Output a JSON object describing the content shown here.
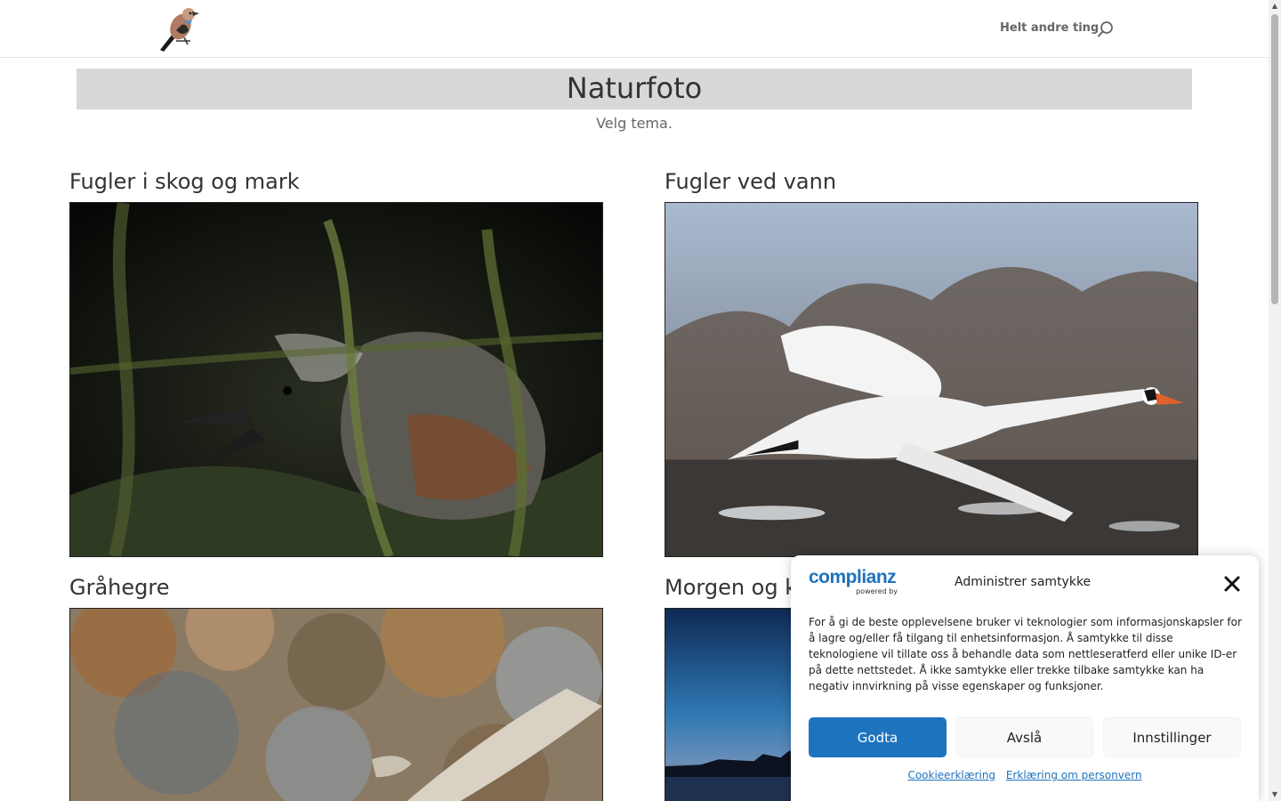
{
  "header": {
    "nav_link": "Helt andre ting"
  },
  "page": {
    "title": "Naturfoto",
    "subtitle": "Velg tema."
  },
  "galleries": [
    {
      "title": "Fugler i skog og mark"
    },
    {
      "title": "Fugler ved vann"
    },
    {
      "title": "Gråhegre"
    },
    {
      "title": "Morgen og k"
    }
  ],
  "cookie": {
    "logo_main": "complianz",
    "logo_sub": "powered by",
    "title": "Administrer samtykke",
    "text": "For å gi de beste opplevelsene bruker vi teknologier som informasjonskapsler for å lagre og/eller få tilgang til enhetsinformasjon. Å samtykke til disse teknologiene vil tillate oss å behandle data som nettleseratferd eller unike ID-er på dette nettstedet. Å ikke samtykke eller trekke tilbake samtykke kan ha negativ innvirkning på visse egenskaper og funksjoner.",
    "accept_label": "Godta",
    "deny_label": "Avslå",
    "settings_label": "Innstillinger",
    "link_cookie": "Cookieerklæring",
    "link_privacy": "Erklæring om personvern"
  },
  "colors": {
    "brand": "#1e73be",
    "title_band": "#d8d8d8"
  }
}
